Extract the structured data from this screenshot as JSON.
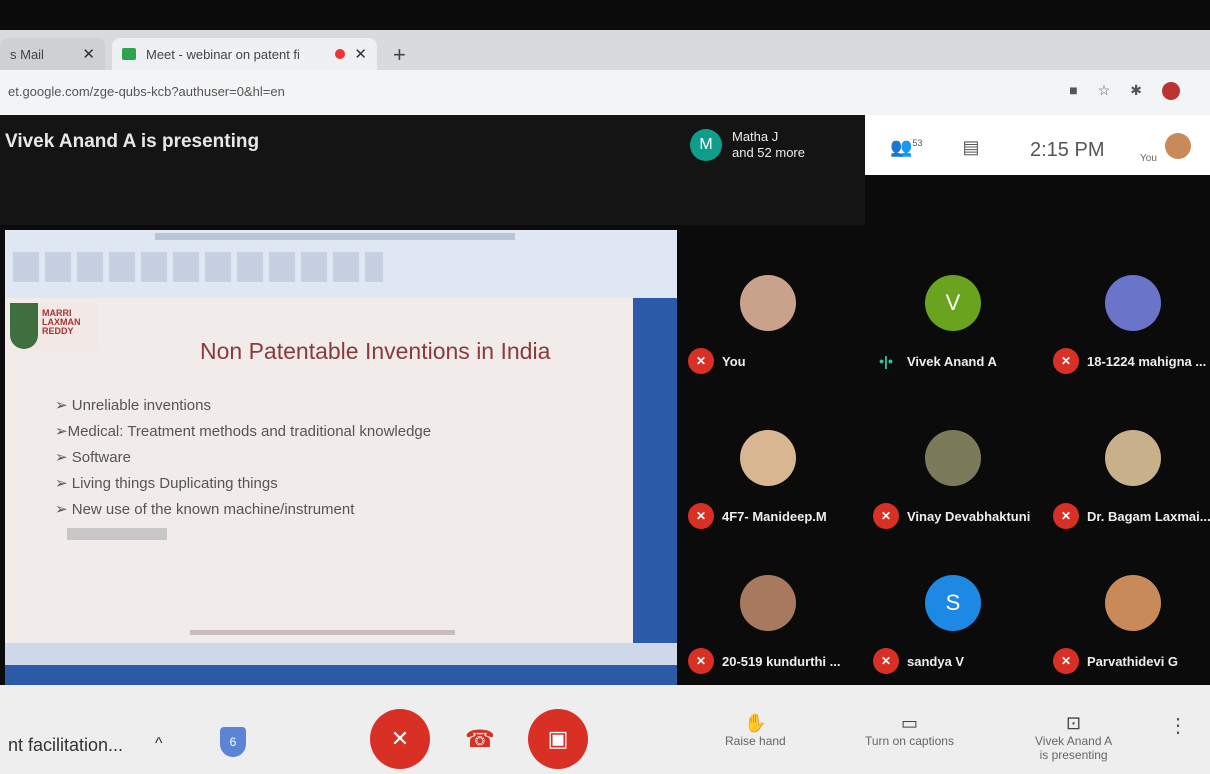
{
  "browser": {
    "tabs": [
      {
        "label": "s Mail",
        "close": "✕"
      },
      {
        "label": "Meet - webinar on patent fi",
        "close": "✕"
      }
    ],
    "new_tab": "+",
    "url": "et.google.com/zge-qubs-kcb?authuser=0&hl=en",
    "window_min": "⊖",
    "window_close": "✕"
  },
  "meet": {
    "presenting_banner": "Vivek Anand A is presenting",
    "participants_avatar": "M",
    "participants_line1": "Matha J",
    "participants_line2": "and 52 more",
    "people_count": "53",
    "time": "2:15 PM",
    "you_label": "You"
  },
  "slide": {
    "logo_text": [
      "MARRI",
      "LAXMAN",
      "REDDY"
    ],
    "title": "Non Patentable Inventions in India",
    "bullets": [
      "➢ Unreliable inventions",
      "➢Medical: Treatment methods and traditional knowledge",
      "➢  Software",
      "➢ Living things Duplicating things",
      "➢ New use of the known machine/instrument"
    ]
  },
  "tiles": [
    {
      "name": "You",
      "avatar": "",
      "avatar_color": "#c9a28c",
      "muted": true
    },
    {
      "name": "Vivek Anand A",
      "avatar": "V",
      "avatar_color": "#6aa31e",
      "muted": false
    },
    {
      "name": "18-1224 mahigna ...",
      "avatar": "",
      "avatar_color": "#6a74c9",
      "muted": true
    },
    {
      "name": "4F7- Manideep.M",
      "avatar": "",
      "avatar_color": "#d8b692",
      "muted": true
    },
    {
      "name": "Vinay Devabhaktuni",
      "avatar": "",
      "avatar_color": "#7b7a5a",
      "muted": true
    },
    {
      "name": "Dr. Bagam Laxmai...",
      "avatar": "",
      "avatar_color": "#c8b08a",
      "muted": true
    },
    {
      "name": "20-519 kundurthi ...",
      "avatar": "",
      "avatar_color": "#a77a60",
      "muted": true
    },
    {
      "name": "sandya V",
      "avatar": "S",
      "avatar_color": "#1e88e5",
      "muted": true
    },
    {
      "name": "Parvathidevi G",
      "avatar": "",
      "avatar_color": "#c98a5a",
      "muted": true
    }
  ],
  "bottom": {
    "meeting_name": "nt facilitation...",
    "chevron": "^",
    "shield_number": "6",
    "raise_hand": "Raise hand",
    "captions": "Turn on captions",
    "presenter_line1": "Vivek Anand A",
    "presenter_line2": "is presenting"
  }
}
